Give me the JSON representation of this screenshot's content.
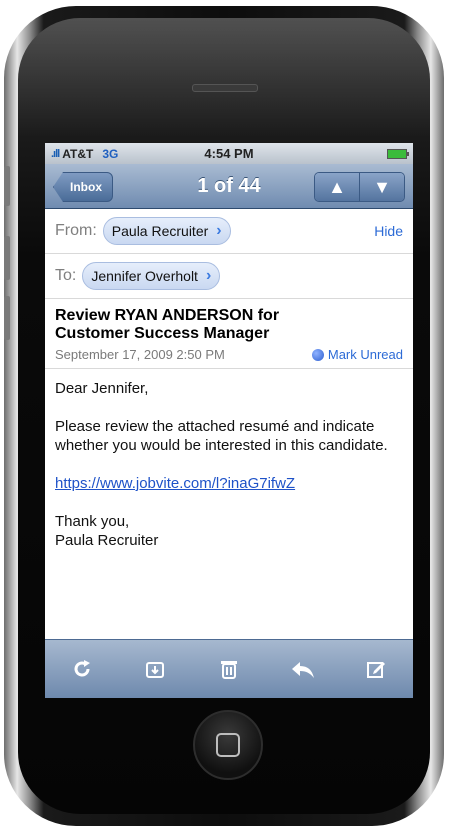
{
  "status_bar": {
    "carrier": "AT&T",
    "network": "3G",
    "time": "4:54 PM"
  },
  "nav": {
    "back_label": "Inbox",
    "title": "1 of 44"
  },
  "header": {
    "from_label": "From:",
    "from_name": "Paula Recruiter",
    "hide_label": "Hide",
    "to_label": "To:",
    "to_name": "Jennifer Overholt"
  },
  "message": {
    "subject_line1": "Review RYAN ANDERSON for",
    "subject_line2": "Customer Success Manager",
    "date": "September 17, 2009 2:50 PM",
    "mark_unread_label": "Mark Unread",
    "greeting": "Dear Jennifer,",
    "paragraph": "Please review the attached resumé and indicate whether you would be interested in this candidate.",
    "link": "https://www.jobvite.com/l?inaG7ifwZ",
    "closing": "Thank you,",
    "signature": "Paula Recruiter"
  },
  "toolbar": {
    "icons": [
      "refresh-icon",
      "move-folder-icon",
      "trash-icon",
      "reply-icon",
      "compose-icon"
    ]
  },
  "colors": {
    "nav_blue": "#6f8bb0",
    "link_blue": "#2d6bd6",
    "unread_dot": "#2d5fd0"
  }
}
